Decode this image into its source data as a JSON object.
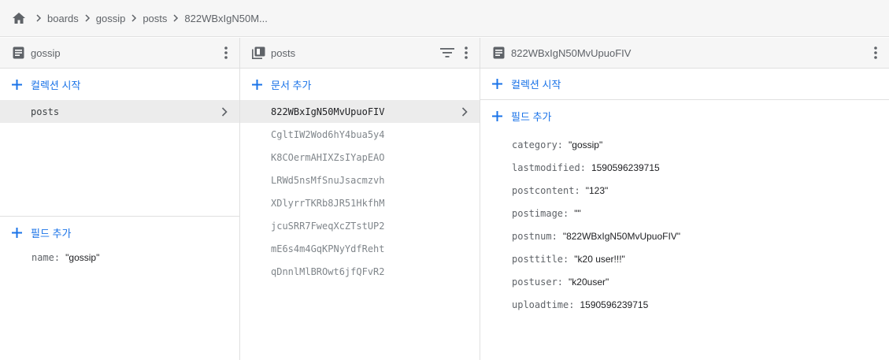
{
  "breadcrumb": {
    "items": [
      "boards",
      "gossip",
      "posts",
      "822WBxIgN50M..."
    ]
  },
  "colors": {
    "accent": "#1a73e8",
    "header_bg": "#f6f6f6",
    "selected_bg": "#ececec"
  },
  "collection_panel": {
    "title": "gossip",
    "start_collection_label": "컬렉션 시작",
    "collections": [
      {
        "name": "posts"
      }
    ],
    "add_field_label": "필드 추가",
    "fields": [
      {
        "key": "name",
        "value": "\"gossip\""
      }
    ]
  },
  "documents_panel": {
    "title": "posts",
    "add_document_label": "문서 추가",
    "documents": [
      {
        "id": "822WBxIgN50MvUpuoFIV"
      },
      {
        "id": "CgltIW2Wod6hY4bua5y4"
      },
      {
        "id": "K8COermAHIXZsIYapEAO"
      },
      {
        "id": "LRWd5nsMfSnuJsacmzvh"
      },
      {
        "id": "XDlyrrTKRb8JR51HkfhM"
      },
      {
        "id": "jcuSRR7FweqXcZTstUP2"
      },
      {
        "id": "mE6s4m4GqKPNyYdfReht"
      },
      {
        "id": "qDnnlMlBROwt6jfQFvR2"
      }
    ]
  },
  "document_panel": {
    "title": "822WBxIgN50MvUpuoFIV",
    "start_collection_label": "컬렉션 시작",
    "add_field_label": "필드 추가",
    "fields": [
      {
        "key": "category",
        "value": "\"gossip\""
      },
      {
        "key": "lastmodified",
        "value": "1590596239715"
      },
      {
        "key": "postcontent",
        "value": "\"123\""
      },
      {
        "key": "postimage",
        "value": "\"\""
      },
      {
        "key": "postnum",
        "value": "\"822WBxIgN50MvUpuoFIV\""
      },
      {
        "key": "posttitle",
        "value": "\"k20 user!!!\""
      },
      {
        "key": "postuser",
        "value": "\"k20user\""
      },
      {
        "key": "uploadtime",
        "value": "1590596239715"
      }
    ]
  }
}
